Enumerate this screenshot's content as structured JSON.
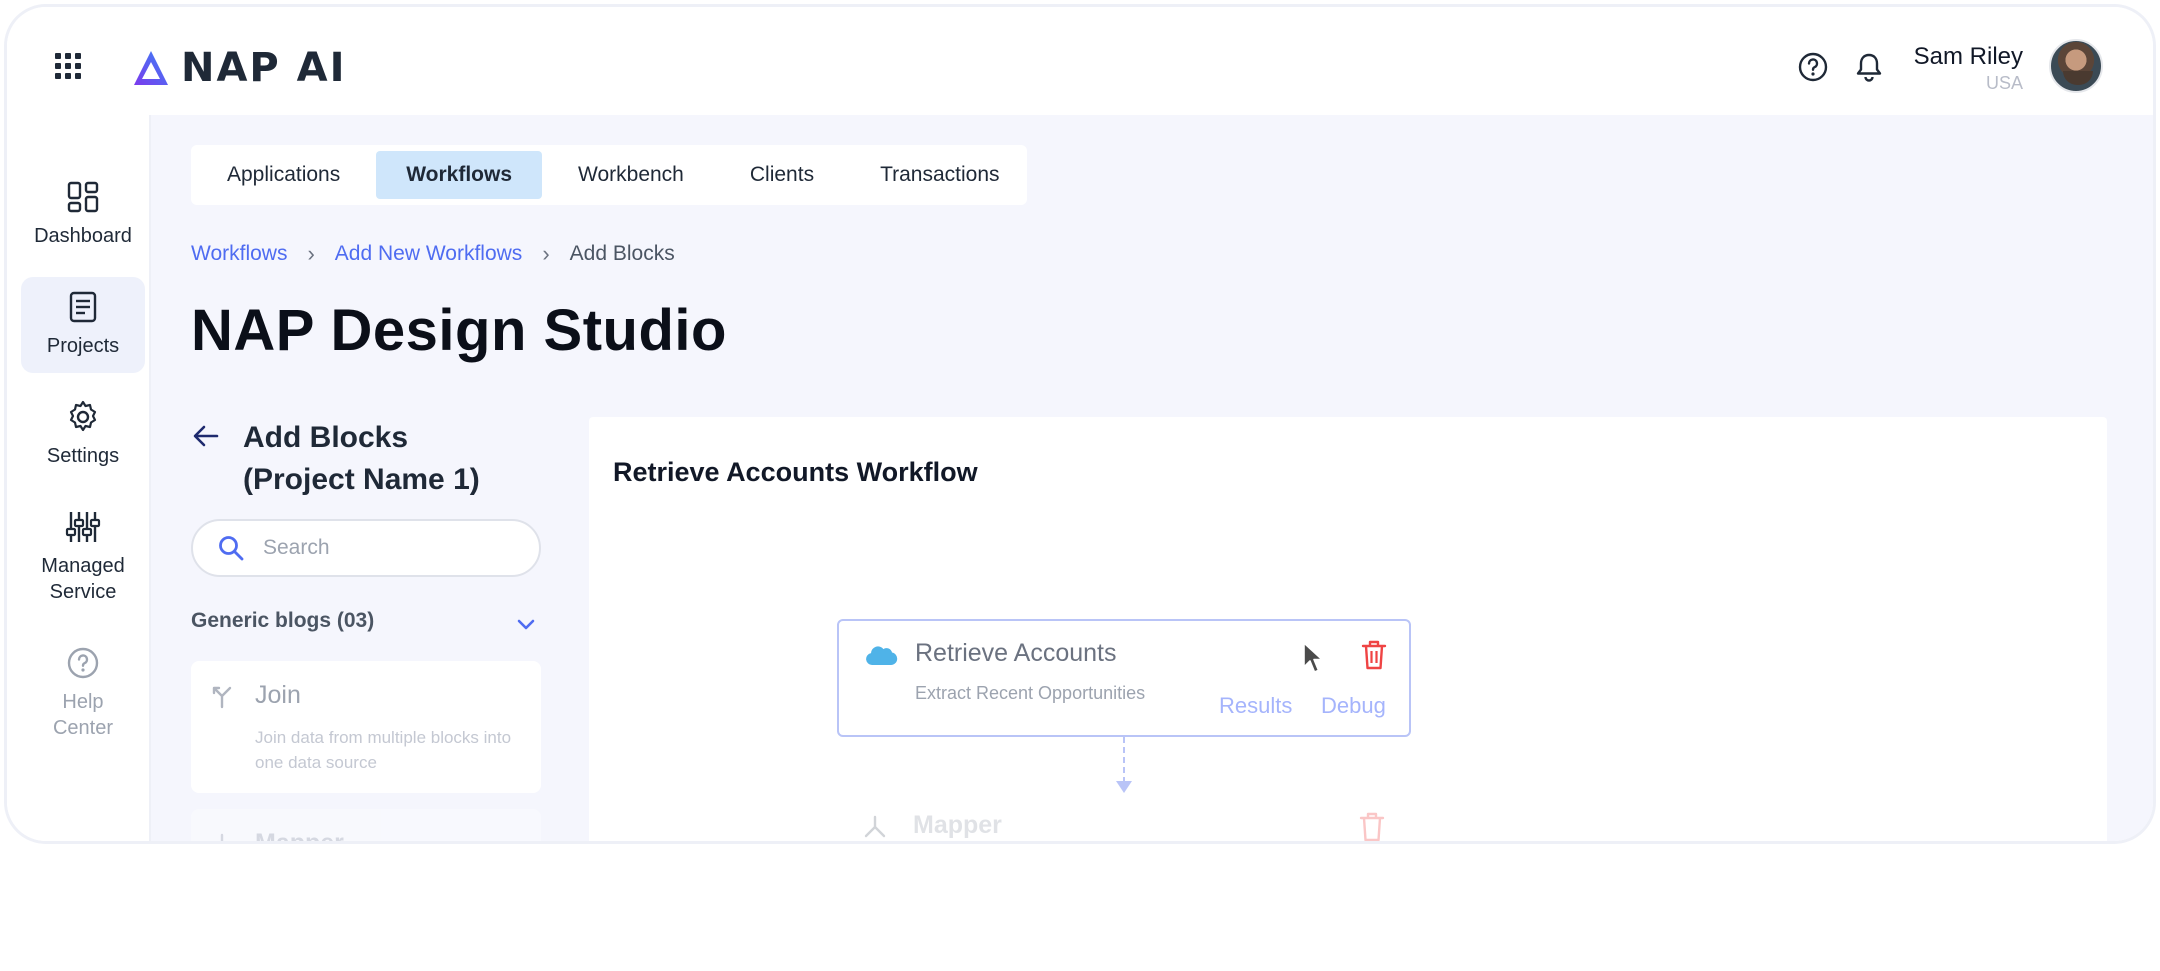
{
  "app": {
    "brand": "NAP AI"
  },
  "header": {
    "user_name": "Sam Riley",
    "user_country": "USA",
    "icons": [
      "apps-grid-icon",
      "help-icon",
      "bell-icon"
    ]
  },
  "sidebar": {
    "items": [
      {
        "label": "Dashboard",
        "icon": "dashboard-icon"
      },
      {
        "label": "Projects",
        "icon": "projects-icon",
        "active": true
      },
      {
        "label": "Settings",
        "icon": "gear-icon"
      },
      {
        "label": "Managed Service",
        "icon": "sliders-icon"
      },
      {
        "label": "Help Center",
        "icon": "help-icon"
      }
    ]
  },
  "tabs": [
    {
      "label": "Applications"
    },
    {
      "label": "Workflows",
      "active": true
    },
    {
      "label": "Workbench"
    },
    {
      "label": "Clients"
    },
    {
      "label": "Transactions"
    }
  ],
  "breadcrumb": {
    "items": [
      "Workflows",
      "Add New Workflows",
      "Add Blocks"
    ]
  },
  "page": {
    "title": "NAP Design Studio"
  },
  "blocks_panel": {
    "title_line1": "Add Blocks",
    "title_line2": "(Project Name 1)",
    "search_placeholder": "Search",
    "group_title": "Generic blogs (03)",
    "blocks": [
      {
        "name": "Join",
        "description": "Join data from multiple blocks into one data source"
      },
      {
        "name": "Mapper",
        "description": ""
      }
    ]
  },
  "canvas": {
    "title": "Retrieve Accounts Workflow",
    "nodes": [
      {
        "title": "Retrieve Accounts",
        "subtitle": "Extract Recent Opportunities",
        "results_label": "Results",
        "debug_label": "Debug"
      },
      {
        "title": "Mapper"
      }
    ]
  },
  "colors": {
    "accent": "#4f6cf1",
    "active_tab": "#cfe6fb",
    "main_bg": "#f5f6fd",
    "danger": "#ef4444",
    "node_border": "#b9c4f7"
  }
}
